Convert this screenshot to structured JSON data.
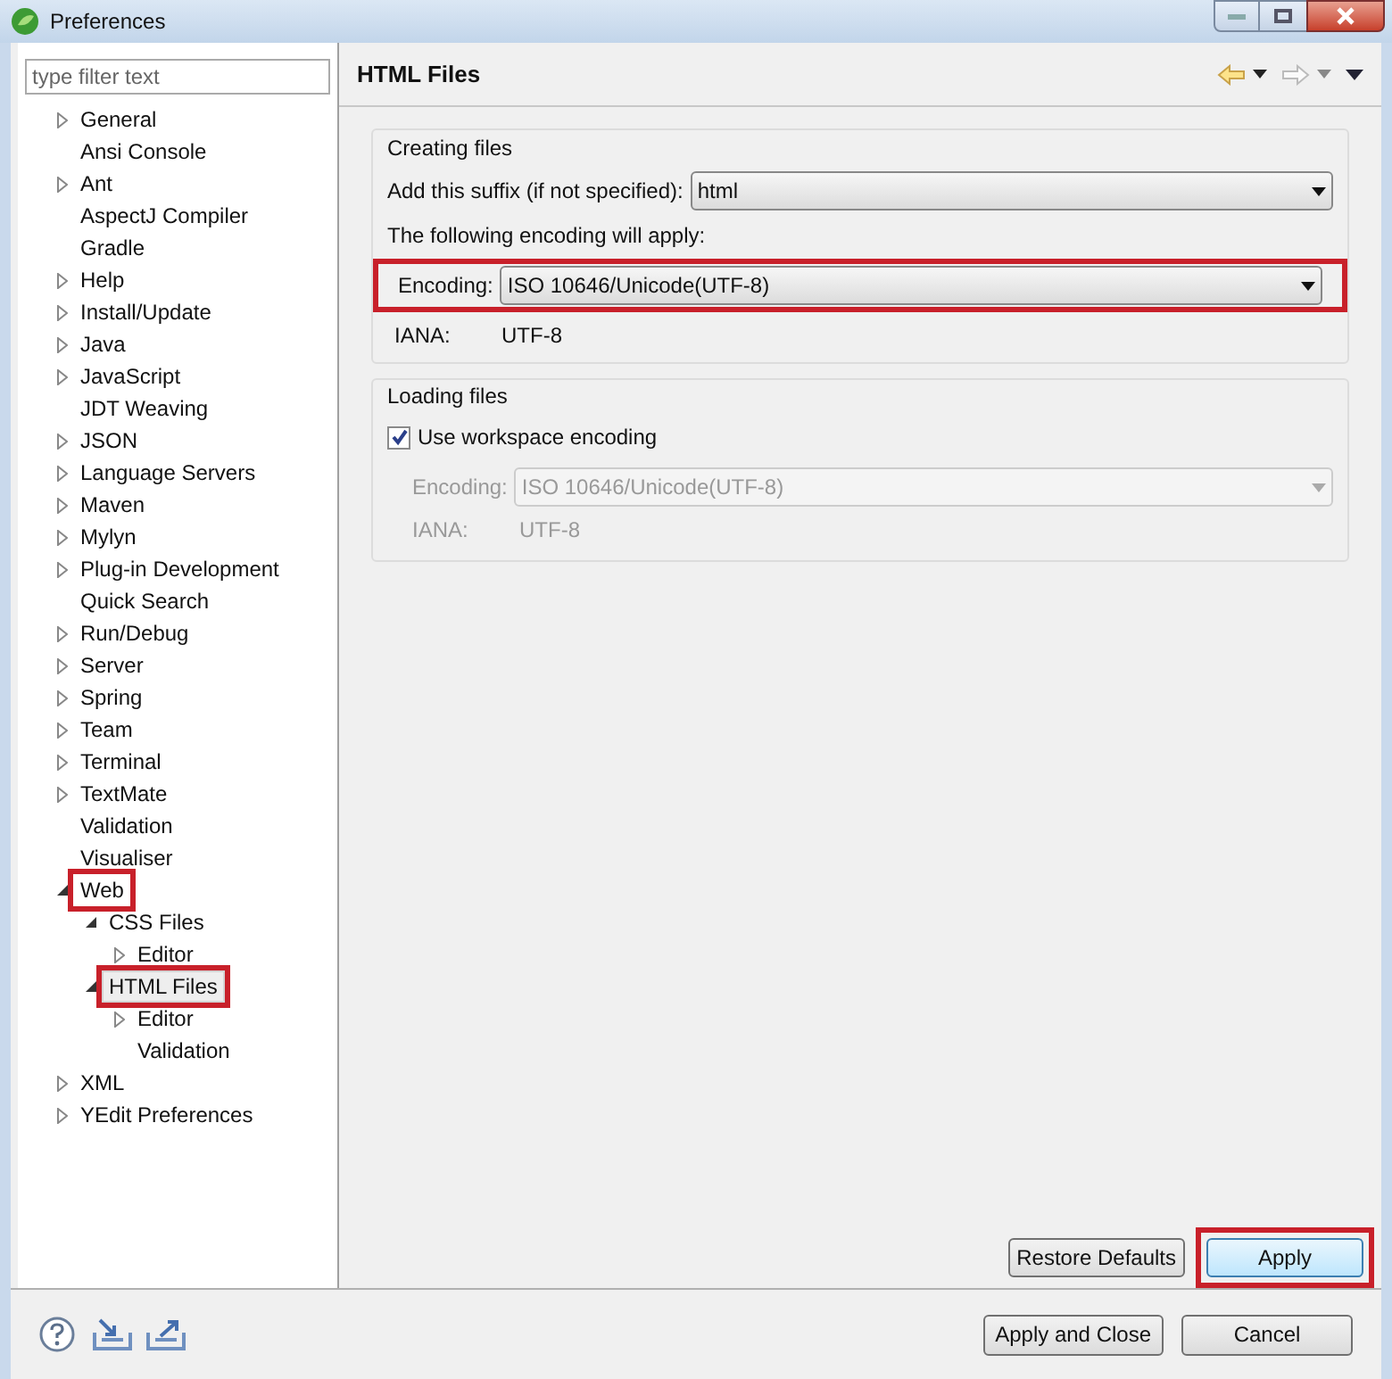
{
  "window": {
    "title": "Preferences"
  },
  "filter": {
    "placeholder": "type filter text"
  },
  "tree": [
    {
      "label": "General",
      "kind": "folder",
      "expanded": false,
      "selected": false,
      "highlighted": false
    },
    {
      "label": "Ansi Console",
      "kind": "leaf",
      "selected": false,
      "highlighted": false
    },
    {
      "label": "Ant",
      "kind": "folder",
      "expanded": false,
      "selected": false,
      "highlighted": false
    },
    {
      "label": "AspectJ Compiler",
      "kind": "leaf",
      "selected": false,
      "highlighted": false
    },
    {
      "label": "Gradle",
      "kind": "leaf",
      "selected": false,
      "highlighted": false
    },
    {
      "label": "Help",
      "kind": "folder",
      "expanded": false,
      "selected": false,
      "highlighted": false
    },
    {
      "label": "Install/Update",
      "kind": "folder",
      "expanded": false,
      "selected": false,
      "highlighted": false
    },
    {
      "label": "Java",
      "kind": "folder",
      "expanded": false,
      "selected": false,
      "highlighted": false
    },
    {
      "label": "JavaScript",
      "kind": "folder",
      "expanded": false,
      "selected": false,
      "highlighted": false
    },
    {
      "label": "JDT Weaving",
      "kind": "leaf",
      "selected": false,
      "highlighted": false
    },
    {
      "label": "JSON",
      "kind": "folder",
      "expanded": false,
      "selected": false,
      "highlighted": false
    },
    {
      "label": "Language Servers",
      "kind": "folder",
      "expanded": false,
      "selected": false,
      "highlighted": false
    },
    {
      "label": "Maven",
      "kind": "folder",
      "expanded": false,
      "selected": false,
      "highlighted": false
    },
    {
      "label": "Mylyn",
      "kind": "folder",
      "expanded": false,
      "selected": false,
      "highlighted": false
    },
    {
      "label": "Plug-in Development",
      "kind": "folder",
      "expanded": false,
      "selected": false,
      "highlighted": false
    },
    {
      "label": "Quick Search",
      "kind": "leaf",
      "selected": false,
      "highlighted": false
    },
    {
      "label": "Run/Debug",
      "kind": "folder",
      "expanded": false,
      "selected": false,
      "highlighted": false
    },
    {
      "label": "Server",
      "kind": "folder",
      "expanded": false,
      "selected": false,
      "highlighted": false
    },
    {
      "label": "Spring",
      "kind": "folder",
      "expanded": false,
      "selected": false,
      "highlighted": false
    },
    {
      "label": "Team",
      "kind": "folder",
      "expanded": false,
      "selected": false,
      "highlighted": false
    },
    {
      "label": "Terminal",
      "kind": "folder",
      "expanded": false,
      "selected": false,
      "highlighted": false
    },
    {
      "label": "TextMate",
      "kind": "folder",
      "expanded": false,
      "selected": false,
      "highlighted": false
    },
    {
      "label": "Validation",
      "kind": "leaf",
      "selected": false,
      "highlighted": false
    },
    {
      "label": "Visualiser",
      "kind": "leaf",
      "selected": false,
      "highlighted": false
    },
    {
      "label": "Web",
      "kind": "folder",
      "expanded": true,
      "selected": false,
      "highlighted": true,
      "children": [
        {
          "label": "CSS Files",
          "kind": "folder",
          "expanded": true,
          "selected": false,
          "highlighted": false,
          "children": [
            {
              "label": "Editor",
              "kind": "folder",
              "expanded": false,
              "selected": false,
              "highlighted": false
            }
          ]
        },
        {
          "label": "HTML Files",
          "kind": "folder",
          "expanded": true,
          "selected": true,
          "highlighted": true,
          "children": [
            {
              "label": "Editor",
              "kind": "folder",
              "expanded": false,
              "selected": false,
              "highlighted": false
            },
            {
              "label": "Validation",
              "kind": "leaf",
              "selected": false,
              "highlighted": false
            }
          ]
        }
      ]
    },
    {
      "label": "XML",
      "kind": "folder",
      "expanded": false,
      "selected": false,
      "highlighted": false
    },
    {
      "label": "YEdit Preferences",
      "kind": "folder",
      "expanded": false,
      "selected": false,
      "highlighted": false
    }
  ],
  "page": {
    "title": "HTML Files"
  },
  "creating_files": {
    "legend": "Creating files",
    "suffix_label": "Add this suffix (if not specified):",
    "suffix_value": "html",
    "note": "The following encoding will apply:",
    "encoding_label": "Encoding:",
    "encoding_value": "ISO 10646/Unicode(UTF-8)",
    "encoding_highlighted": true,
    "iana_label": "IANA:",
    "iana_value": "UTF-8"
  },
  "loading_files": {
    "legend": "Loading files",
    "checkbox_label": "Use workspace encoding",
    "checked": true,
    "encoding_label": "Encoding:",
    "encoding_value": "ISO 10646/Unicode(UTF-8)",
    "disabled": true,
    "iana_label": "IANA:",
    "iana_value": "UTF-8"
  },
  "page_buttons": [
    {
      "label": "Restore Defaults",
      "highlighted": false,
      "focused": false
    },
    {
      "label": "Apply",
      "highlighted": true,
      "focused": true
    }
  ],
  "dialog_buttons": [
    "Apply and Close",
    "Cancel"
  ]
}
